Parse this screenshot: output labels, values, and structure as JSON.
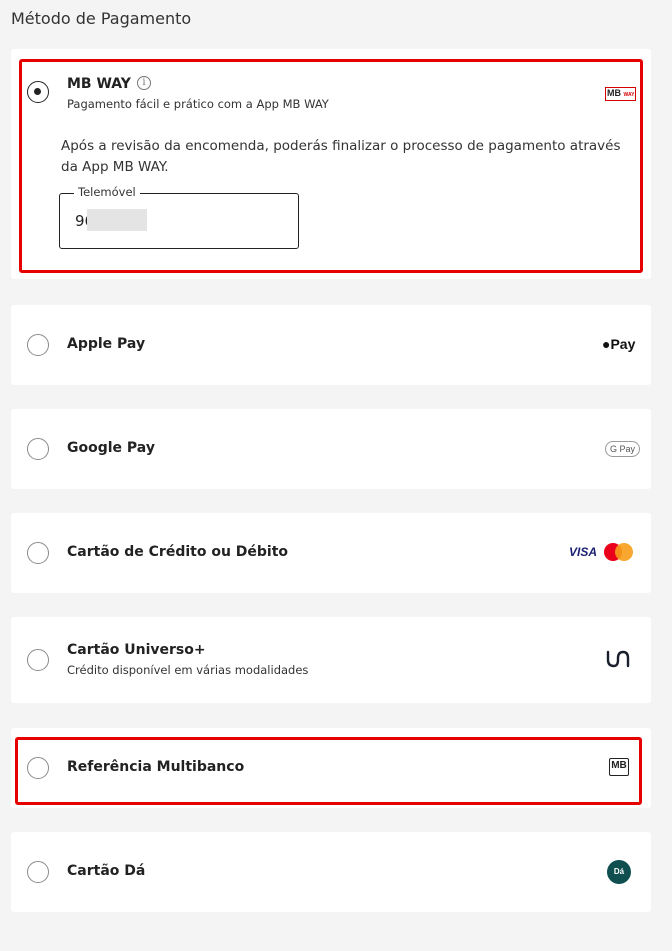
{
  "page": {
    "title": "Método de Pagamento"
  },
  "options": [
    {
      "label": "MB WAY",
      "subtitle": "Pagamento fácil e prático com a App MB WAY",
      "selected": true,
      "description": "Após a revisão da encomenda, poderás finalizar o processo de pagamento através da App MB WAY.",
      "phone": {
        "label": "Telemóvel",
        "value": "96          0"
      },
      "logo": "mbway-logo",
      "logo_text": "MB WAY"
    },
    {
      "label": "Apple Pay",
      "logo": "apple-pay-logo",
      "logo_text": "Pay"
    },
    {
      "label": "Google Pay",
      "logo": "google-pay-logo",
      "logo_text": "G Pay"
    },
    {
      "label": "Cartão de Crédito ou Débito",
      "logo": "visa-mastercard-logo",
      "logo_text": "VISA"
    },
    {
      "label": "Cartão Universo+",
      "subtitle": "Crédito disponível em várias modalidades",
      "logo": "universo-logo"
    },
    {
      "label": "Referência Multibanco",
      "logo": "multibanco-logo",
      "logo_text": "MB"
    },
    {
      "label": "Cartão Dá",
      "logo": "cartao-da-logo",
      "logo_text": "Dá"
    }
  ],
  "colors": {
    "highlight": "#e60000",
    "background": "#f4f4f4",
    "card": "#ffffff",
    "visa": "#1a1f71",
    "mastercard_red": "#eb001b",
    "mastercard_orange": "#f79e1b",
    "cartao_da": "#0f4f50"
  }
}
